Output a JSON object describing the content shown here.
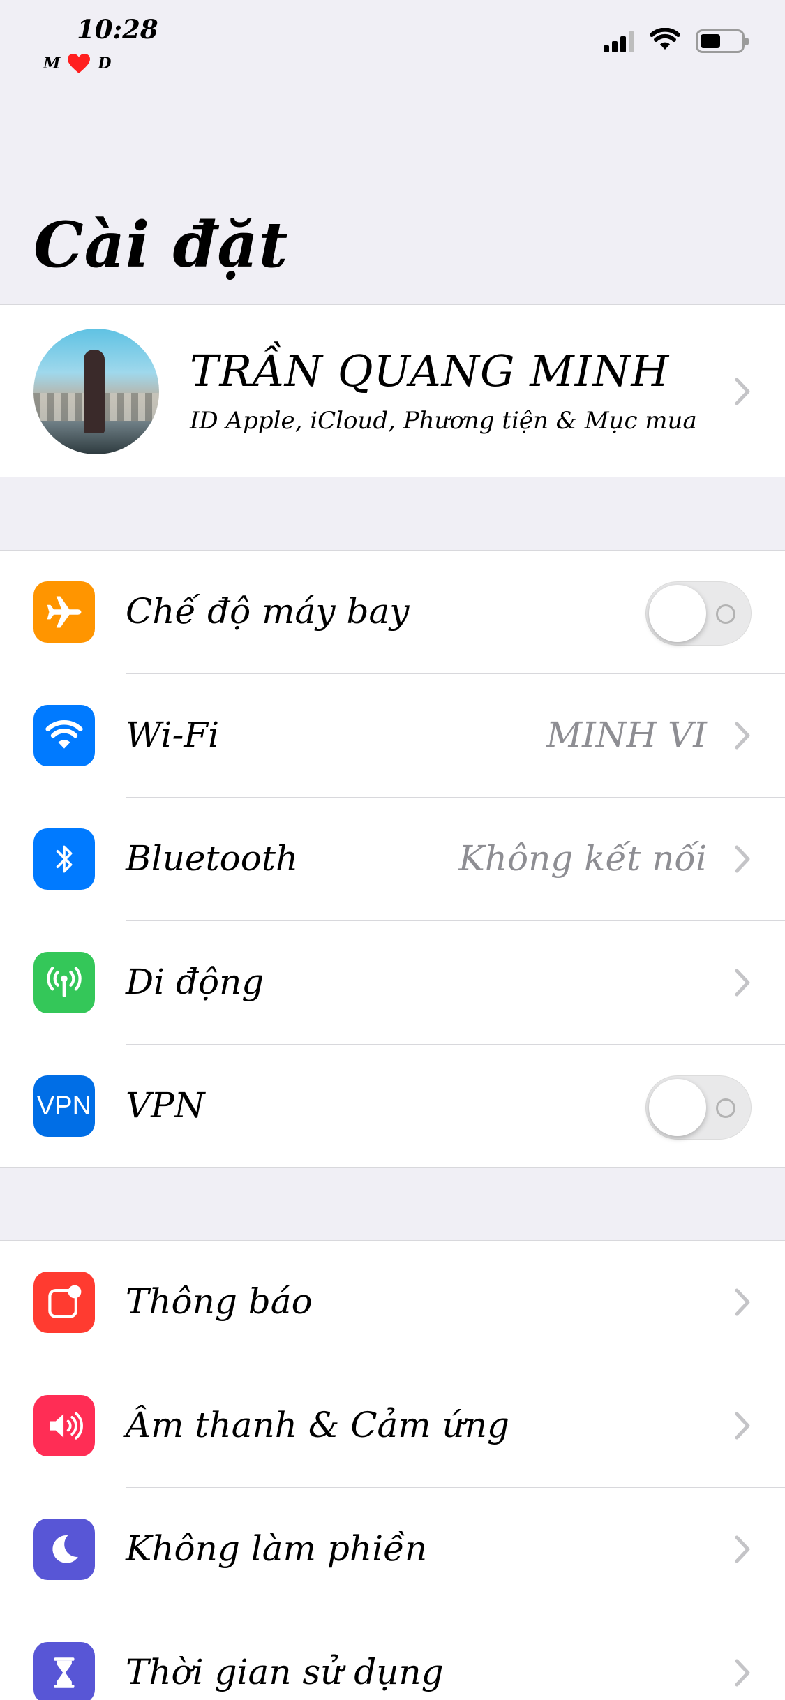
{
  "status_bar": {
    "time": "10:28",
    "carrier_left": "M",
    "carrier_right": "D",
    "heart_icon": "heart-icon",
    "signal_icon": "cellular-signal-icon",
    "wifi_icon": "wifi-icon",
    "battery_icon": "battery-icon"
  },
  "title": "Cài đặt",
  "profile": {
    "name": "TRẦN QUANG MINH",
    "subtitle": "ID Apple, iCloud, Phương tiện & Mục mua",
    "avatar": "avatar"
  },
  "group1": [
    {
      "label": "Chế độ máy bay",
      "icon": "airplane-icon",
      "color": "#ff9500",
      "control": "toggle",
      "on": false
    },
    {
      "label": "Wi-Fi",
      "icon": "wifi-icon",
      "color": "#007aff",
      "value": "MINH VI",
      "control": "chevron"
    },
    {
      "label": "Bluetooth",
      "icon": "bluetooth-icon",
      "color": "#007aff",
      "value": "Không kết nối",
      "control": "chevron"
    },
    {
      "label": "Di động",
      "icon": "antenna-icon",
      "color": "#34c759",
      "control": "chevron"
    },
    {
      "label": "VPN",
      "icon": "vpn-icon",
      "icon_text": "VPN",
      "color": "#006ee6",
      "control": "toggle",
      "on": false
    }
  ],
  "group2": [
    {
      "label": "Thông báo",
      "icon": "notifications-icon",
      "color": "#ff3b30",
      "control": "chevron"
    },
    {
      "label": "Âm thanh & Cảm ứng",
      "icon": "speaker-icon",
      "color": "#ff2d55",
      "control": "chevron"
    },
    {
      "label": "Không làm phiền",
      "icon": "moon-icon",
      "color": "#5856d6",
      "control": "chevron"
    },
    {
      "label": "Thời gian sử dụng",
      "icon": "hourglass-icon",
      "color": "#5856d6",
      "control": "chevron"
    }
  ]
}
